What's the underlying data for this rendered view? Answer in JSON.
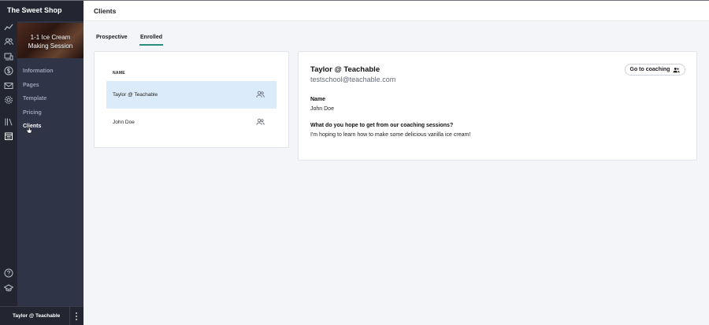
{
  "app": {
    "school_name": "The Sweet Shop"
  },
  "course": {
    "title": "1-1 Ice Cream Making Session"
  },
  "rail_icons": [
    "analytics-icon",
    "users-icon",
    "devices-icon",
    "dollar-icon",
    "mail-icon",
    "gear-icon",
    "library-icon",
    "calendar-icon",
    "help-icon",
    "graduation-cap-icon"
  ],
  "sidebar": {
    "items": [
      {
        "label": "Information",
        "active": false
      },
      {
        "label": "Pages",
        "active": false
      },
      {
        "label": "Template",
        "active": false
      },
      {
        "label": "Pricing",
        "active": false
      },
      {
        "label": "Clients",
        "active": true
      }
    ]
  },
  "user": {
    "name": "Taylor @ Teachable"
  },
  "header": {
    "title": "Clients"
  },
  "tabs": [
    {
      "label": "Prospective",
      "active": false
    },
    {
      "label": "Enrolled",
      "active": true
    }
  ],
  "client_list": {
    "column_header": "NAME",
    "rows": [
      {
        "name": "Taylor @ Teachable",
        "selected": true
      },
      {
        "name": "John Doe",
        "selected": false
      }
    ]
  },
  "client_detail": {
    "name": "Taylor @ Teachable",
    "email": "testschool@teachable.com",
    "coaching_button": "Go to coaching",
    "fields": [
      {
        "label": "Name",
        "value": "John Doe"
      },
      {
        "label": "What do you hope to get from our coaching sessions?",
        "value": "I'm hoping to learn how to make some delicious vanilla ice cream!"
      }
    ]
  },
  "colors": {
    "sidebar_dark": "#232630",
    "course_panel": "#2f3447",
    "tab_underline": "#2a8f7a",
    "selected_row": "#dcebf9"
  }
}
